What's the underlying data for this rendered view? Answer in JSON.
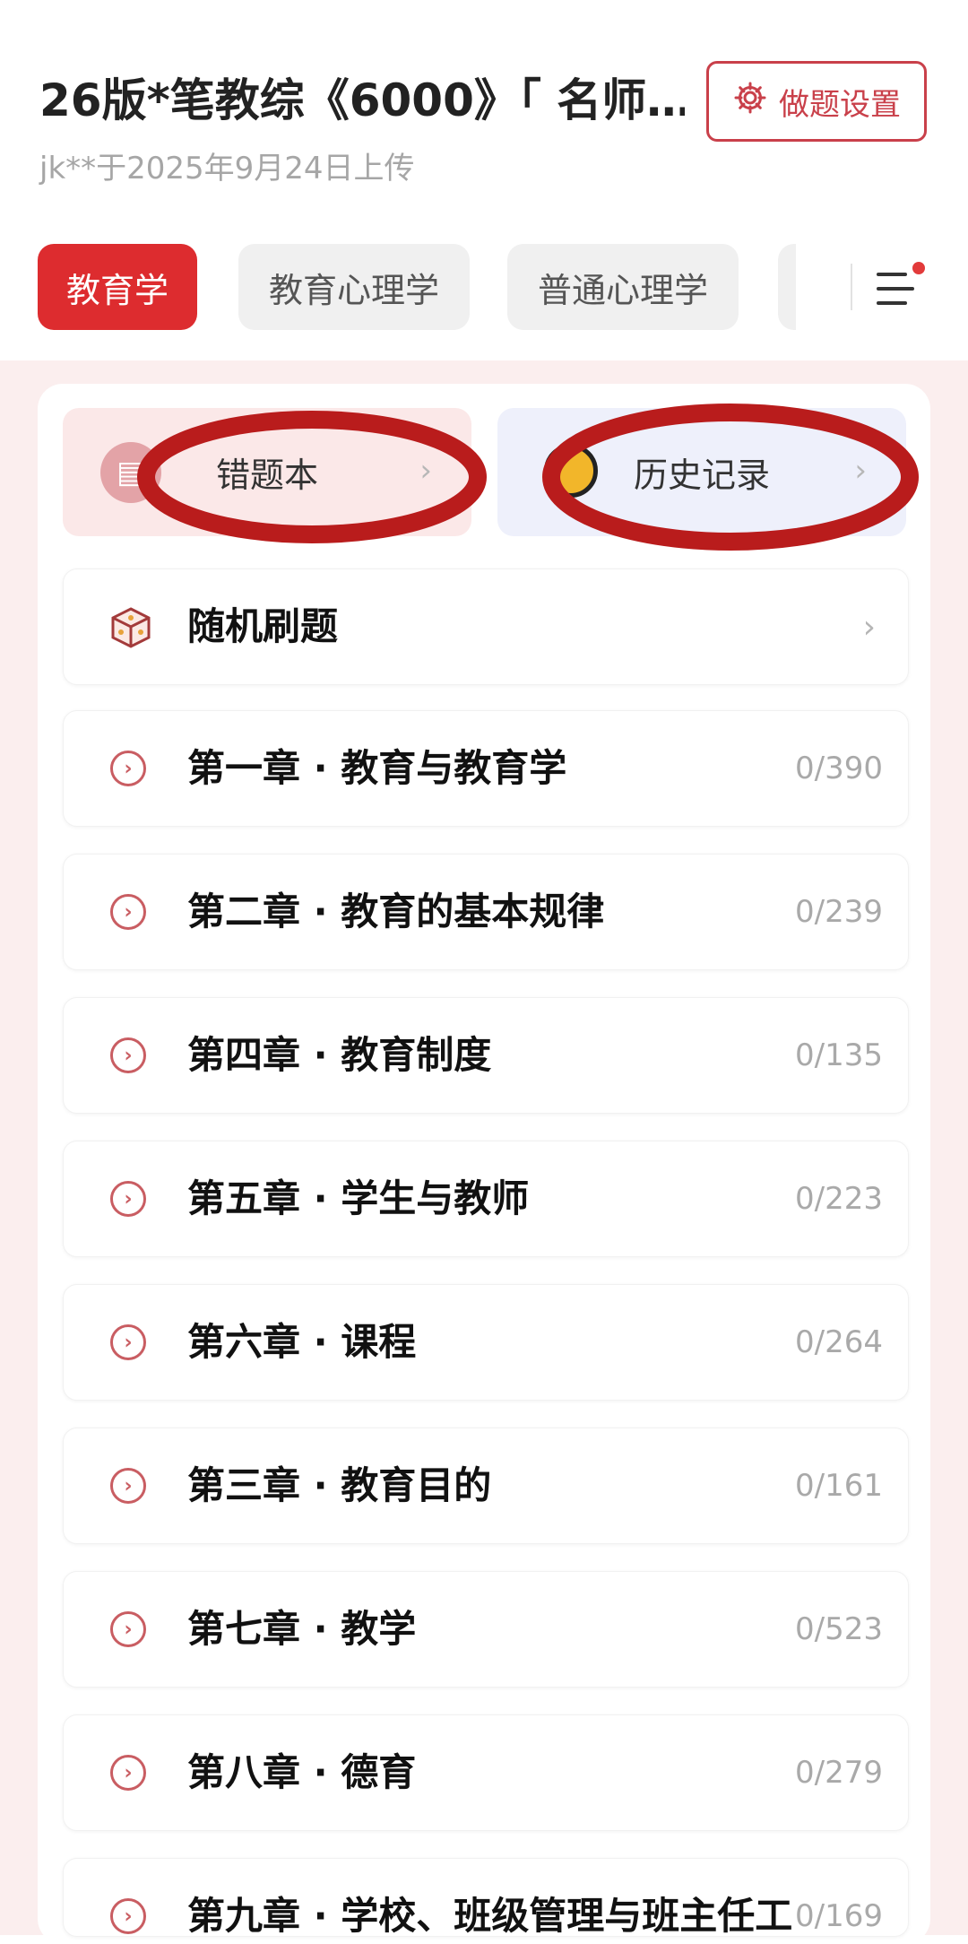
{
  "header": {
    "title": "26版*笔教综《6000》「 名师…",
    "subtitle": "jk**于2025年9月24日上传",
    "settings_label": "做题设置"
  },
  "tabs": [
    {
      "label": "教育学",
      "active": true
    },
    {
      "label": "教育心理学",
      "active": false
    },
    {
      "label": "普通心理学",
      "active": false
    }
  ],
  "quick_actions": {
    "wrong_book_label": "错题本",
    "history_label": "历史记录"
  },
  "random_practice_label": "随机刷题",
  "chapters": [
    {
      "label": "第一章 · 教育与教育学",
      "count": "0/390"
    },
    {
      "label": "第二章 · 教育的基本规律",
      "count": "0/239"
    },
    {
      "label": "第四章 · 教育制度",
      "count": "0/135"
    },
    {
      "label": "第五章 · 学生与教师",
      "count": "0/223"
    },
    {
      "label": "第六章 · 课程",
      "count": "0/264"
    },
    {
      "label": "第三章 · 教育目的",
      "count": "0/161"
    },
    {
      "label": "第七章 · 教学",
      "count": "0/523"
    },
    {
      "label": "第八章 · 德育",
      "count": "0/279"
    },
    {
      "label": "第九章 · 学校、班级管理与班主任工",
      "count": "0/169"
    }
  ],
  "colors": {
    "accent": "#dd2c2f",
    "annotation": "#b91c1c",
    "page_background": "#fbeeee"
  },
  "icons": [
    "gear-icon",
    "menu-icon",
    "notebook-icon",
    "clock-icon",
    "chevron-right-icon",
    "dice-icon",
    "chevron-circle-icon"
  ]
}
